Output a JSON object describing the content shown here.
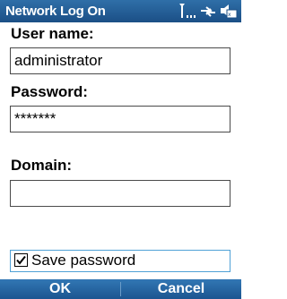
{
  "window": {
    "title": "Network Log On"
  },
  "status_icons": [
    "signal-icon",
    "sync-icon",
    "speaker-icon"
  ],
  "form": {
    "username": {
      "label": "User name:",
      "value": "administrator"
    },
    "password": {
      "label": "Password:",
      "value": "*******"
    },
    "domain": {
      "label": "Domain:",
      "value": ""
    },
    "save_password": {
      "label": "Save password",
      "checked": true
    }
  },
  "softkeys": {
    "left": "OK",
    "right": "Cancel"
  },
  "colors": {
    "titlebar": "#1f5a94",
    "softkeys": "#2266a4",
    "focus_border": "#4fa1d6"
  }
}
